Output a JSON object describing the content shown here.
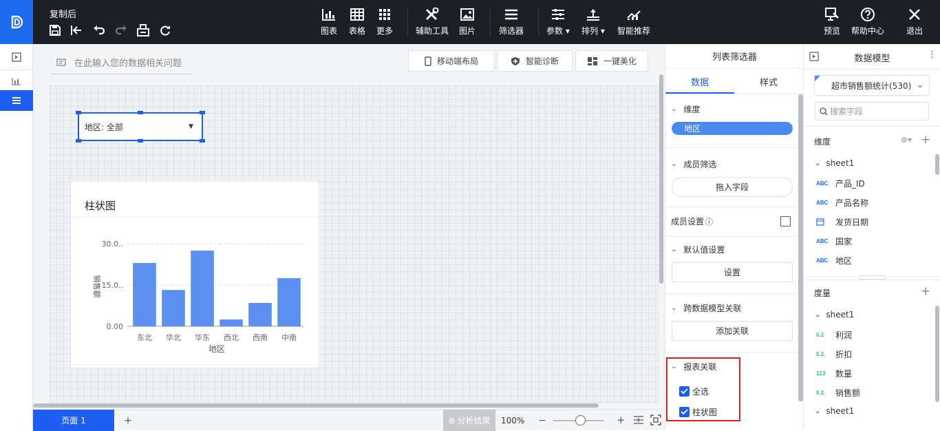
{
  "app": {
    "title": "复制后"
  },
  "toolbar": {
    "chart": "图表",
    "table": "表格",
    "more": "更多",
    "aux_tools": "辅助工具",
    "image": "图片",
    "filter": "筛选器",
    "params": "参数",
    "sort": "排列",
    "smart_rec": "智能推荐",
    "preview": "预览",
    "help": "帮助中心",
    "exit": "退出"
  },
  "canvas": {
    "ask_placeholder": "在此输入您的数据相关问题",
    "mobile_layout": "移动端布局",
    "diagnose": "智能诊断",
    "beautify": "一键美化",
    "filter_widget": {
      "label": "地区: 全部"
    }
  },
  "chart_data": {
    "type": "bar",
    "title": "柱状图",
    "xlabel": "地区",
    "ylabel": "销售额",
    "categories": [
      "东北",
      "华北",
      "华东",
      "西北",
      "西南",
      "中南"
    ],
    "values": [
      23.0,
      13.2,
      27.5,
      2.5,
      8.5,
      17.5
    ],
    "ylim": [
      0,
      30
    ],
    "yticks": [
      "0.00",
      "15.0..",
      "30.0.."
    ],
    "grid": true,
    "color": "#5b8ff0"
  },
  "bottom": {
    "page_tab": "页面 1",
    "add_page": "+",
    "analysis": "分析结果",
    "zoom": "100%"
  },
  "filter_panel": {
    "title": "列表筛选器",
    "tab_data": "数据",
    "tab_style": "样式",
    "dimension_label": "维度",
    "dimension_field": "地区",
    "member_filter_label": "成员筛选",
    "drag_field": "拖入字段",
    "member_setting_label": "成员设置",
    "default_setting_label": "默认值设置",
    "set_button": "设置",
    "cross_model_label": "跨数据模型关联",
    "add_link_button": "添加关联",
    "report_link_label": "报表关联",
    "select_all": "全选",
    "bar_chart_item": "柱状图",
    "accent": "#1d5ef0",
    "highlight": "#e02020"
  },
  "model_panel": {
    "title": "数据模型",
    "dataset": "超市销售额统计(530)",
    "search_placeholder": "搜索字段",
    "dimension_label": "维度",
    "sheet": "sheet1",
    "dimension_fields": [
      {
        "type": "ABC",
        "name": "产品_ID"
      },
      {
        "type": "ABC",
        "name": "产品名称"
      },
      {
        "type": "date",
        "name": "发货日期"
      },
      {
        "type": "ABC",
        "name": "国家"
      },
      {
        "type": "ABC",
        "name": "地区"
      }
    ],
    "measure_label": "度量",
    "measure_fields": [
      {
        "type": "0.2",
        "name": "利润"
      },
      {
        "type": "0.2",
        "name": "折扣"
      },
      {
        "type": "123",
        "name": "数量"
      },
      {
        "type": "0.2",
        "name": "销售额"
      }
    ],
    "sheet2": "sheet1"
  }
}
